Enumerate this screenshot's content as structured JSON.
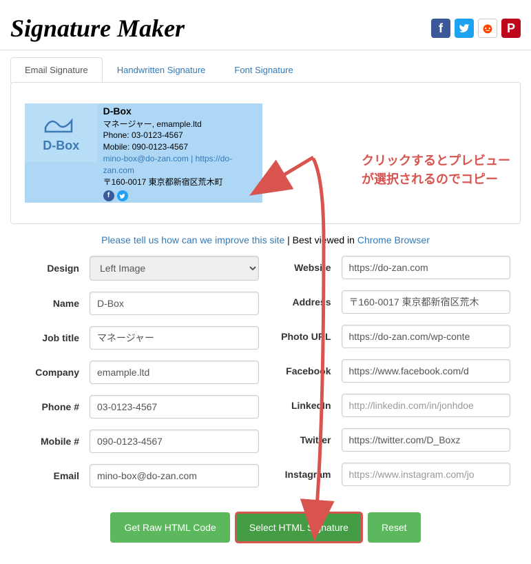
{
  "header": {
    "logo": "Signature Maker"
  },
  "tabs": [
    "Email Signature",
    "Handwritten Signature",
    "Font Signature"
  ],
  "preview": {
    "logo_text": "D-Box",
    "name": "D-Box",
    "role_line": "マネージャー, emample.ltd",
    "phone": "Phone: 03-0123-4567",
    "mobile": "Mobile: 090-0123-4567",
    "email": "mino-box@do-zan.com",
    "sep": " | ",
    "site": "https://do-zan.com",
    "address": "〒160-0017 東京都新宿区荒木町"
  },
  "improve": {
    "link1": "Please tell us how can we improve this site",
    "mid": " | Best viewed in ",
    "link2": "Chrome Browser"
  },
  "form_left": {
    "Design": {
      "label": "Design",
      "value": "Left Image",
      "type": "select"
    },
    "Name": {
      "label": "Name",
      "value": "D-Box"
    },
    "Job title": {
      "label": "Job title",
      "value": "マネージャー"
    },
    "Company": {
      "label": "Company",
      "value": "emample.ltd"
    },
    "Phone #": {
      "label": "Phone #",
      "value": "03-0123-4567"
    },
    "Mobile #": {
      "label": "Mobile #",
      "value": "090-0123-4567"
    },
    "Email": {
      "label": "Email",
      "value": "mino-box@do-zan.com"
    }
  },
  "form_right": {
    "Website": {
      "label": "Website",
      "value": "https://do-zan.com"
    },
    "Address": {
      "label": "Address",
      "value": "〒160-0017 東京都新宿区荒木"
    },
    "Photo URL": {
      "label": "Photo URL",
      "value": "https://do-zan.com/wp-conte"
    },
    "Facebook": {
      "label": "Facebook",
      "value": "https://www.facebook.com/d"
    },
    "LinkedIn": {
      "label": "LinkedIn",
      "placeholder": "http://linkedin.com/in/jonhdoe"
    },
    "Twitter": {
      "label": "Twitter",
      "value": "https://twitter.com/D_Boxz"
    },
    "Instagram": {
      "label": "Instagram",
      "placeholder": "https://www.instagram.com/jo"
    }
  },
  "buttons": {
    "raw": "Get Raw HTML Code",
    "select": "Select HTML Signature",
    "reset": "Reset"
  },
  "annotation": {
    "line1": "クリックするとプレビュー",
    "line2": "が選択されるのでコピー"
  }
}
